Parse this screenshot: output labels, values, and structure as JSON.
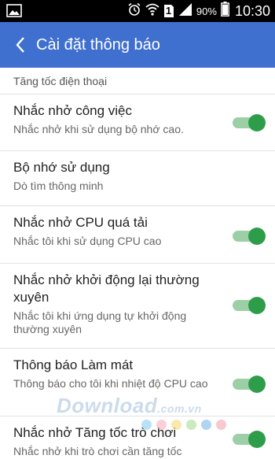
{
  "status_bar": {
    "battery": "90%",
    "time": "10:30",
    "sim_slot": "1",
    "icons": [
      "gallery-icon",
      "alarm-icon",
      "wifi-icon",
      "sim-icon",
      "signal-icon",
      "battery-icon"
    ]
  },
  "app_bar": {
    "title": "Cài đặt thông báo",
    "color": "#3f6fcf"
  },
  "section_header": "Tăng tốc điện thoại",
  "settings": [
    {
      "title": "Nhắc nhở công việc",
      "subtitle": "Nhắc nhở khi sử dụng bộ nhớ cao.",
      "toggle": true
    },
    {
      "title": "Bộ nhớ sử dụng",
      "subtitle": "Dò tìm thông minh",
      "toggle": null
    },
    {
      "title": "Nhắc nhở CPU quá tải",
      "subtitle": "Nhắc tôi khi sử dụng CPU cao",
      "toggle": true
    },
    {
      "title": "Nhắc nhở khởi động lại thường xuyên",
      "subtitle": "Nhắc tôi khi ứng dụng tự khởi động thường xuyên",
      "toggle": true
    },
    {
      "title": "Thông báo Làm mát",
      "subtitle": "Thông báo cho tôi khi nhiệt độ CPU cao",
      "toggle": true
    },
    {
      "title": "Nhắc nhở Tăng tốc trò chơi",
      "subtitle": "Nhắc nhở khi trò chơi cần tăng tốc",
      "toggle": true
    }
  ],
  "watermark": {
    "brand": "Download",
    "domain": ".com.vn"
  },
  "colors": {
    "toggle_on": "#2e9d4a",
    "toggle_track": "#9ccfa6"
  }
}
